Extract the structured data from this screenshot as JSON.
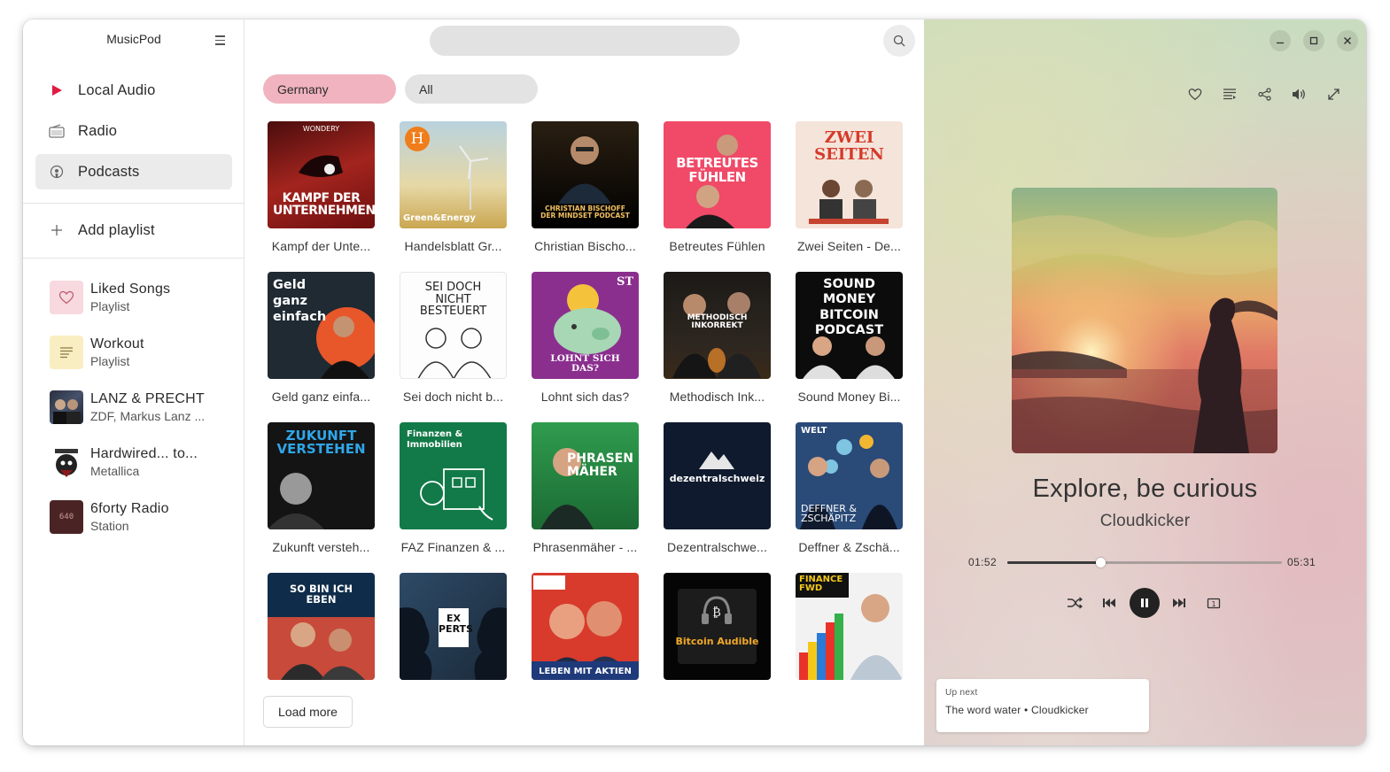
{
  "app": {
    "title": "MusicPod"
  },
  "sidebar": {
    "nav": [
      {
        "label": "Local Audio",
        "icon": "play-icon"
      },
      {
        "label": "Radio",
        "icon": "radio-icon"
      },
      {
        "label": "Podcasts",
        "icon": "podcast-icon",
        "selected": true
      }
    ],
    "add_playlist": "Add playlist",
    "playlists": [
      {
        "title": "Liked Songs",
        "subtitle": "Playlist",
        "icon": "heart-icon"
      },
      {
        "title": "Workout",
        "subtitle": "Playlist",
        "icon": "list-icon"
      },
      {
        "title": "LANZ & PRECHT",
        "subtitle": "ZDF, Markus Lanz ..."
      },
      {
        "title": "Hardwired... to...",
        "subtitle": "Metallica"
      },
      {
        "title": "6forty Radio",
        "subtitle": "Station",
        "cover_text": "640"
      }
    ]
  },
  "main": {
    "search_placeholder": "",
    "chips": [
      {
        "label": "Germany",
        "selected": true
      },
      {
        "label": "All",
        "selected": false
      }
    ],
    "podcasts": [
      {
        "label": "Kampf der Unte...",
        "cover_text": "KAMPF DER UNTERNEHMEN",
        "top_text": "WONDERY"
      },
      {
        "label": "Handelsblatt Gr...",
        "cover_text": "Green&Energy",
        "top_text": "H"
      },
      {
        "label": "Christian Bischo...",
        "cover_text": "CHRISTIAN BISCHOFF DER MINDSET PODCAST"
      },
      {
        "label": "Betreutes Fühlen",
        "cover_text": "BETREUTES FÜHLEN"
      },
      {
        "label": "Zwei Seiten - De...",
        "cover_text": "ZWEI SEITEN"
      },
      {
        "label": "Geld ganz einfa...",
        "cover_text": "Geld ganz einfach"
      },
      {
        "label": "Sei doch nicht b...",
        "cover_text": "SEI DOCH NICHT BESTEUERT"
      },
      {
        "label": "Lohnt sich das?",
        "cover_text": "LOHNT SICH DAS?",
        "top_text": "ST"
      },
      {
        "label": "Methodisch Ink...",
        "cover_text": "METHODISCH INKORREKT"
      },
      {
        "label": "Sound Money Bi...",
        "cover_text": "SOUND MONEY BITCOIN PODCAST"
      },
      {
        "label": "Zukunft versteh...",
        "cover_text": "ZUKUNFT VERSTEHEN"
      },
      {
        "label": "FAZ Finanzen & ...",
        "cover_text": "Finanzen & Immobilien"
      },
      {
        "label": "Phrasenmäher - ...",
        "cover_text": "PHRASEN MÄHER"
      },
      {
        "label": "Dezentralschwe...",
        "cover_text": "dezentralschweiz"
      },
      {
        "label": "Deffner & Zschä...",
        "cover_text": "DEFFNER & ZSCHÄPITZ",
        "top_text": "WELT"
      },
      {
        "label": "",
        "cover_text": "SO BIN ICH EBEN"
      },
      {
        "label": "",
        "cover_text": "EX PERTS"
      },
      {
        "label": "",
        "cover_text": "LEBEN MIT AKTIEN"
      },
      {
        "label": "",
        "cover_text": "Bitcoin Audible"
      },
      {
        "label": "",
        "cover_text": "FINANCE FWD"
      }
    ],
    "load_more": "Load more"
  },
  "player": {
    "title": "Explore, be curious",
    "artist": "Cloudkicker",
    "elapsed": "01:52",
    "duration": "05:31",
    "progress": 0.338,
    "up_next_heading": "Up next",
    "up_next_track": "The word water • Cloudkicker"
  }
}
